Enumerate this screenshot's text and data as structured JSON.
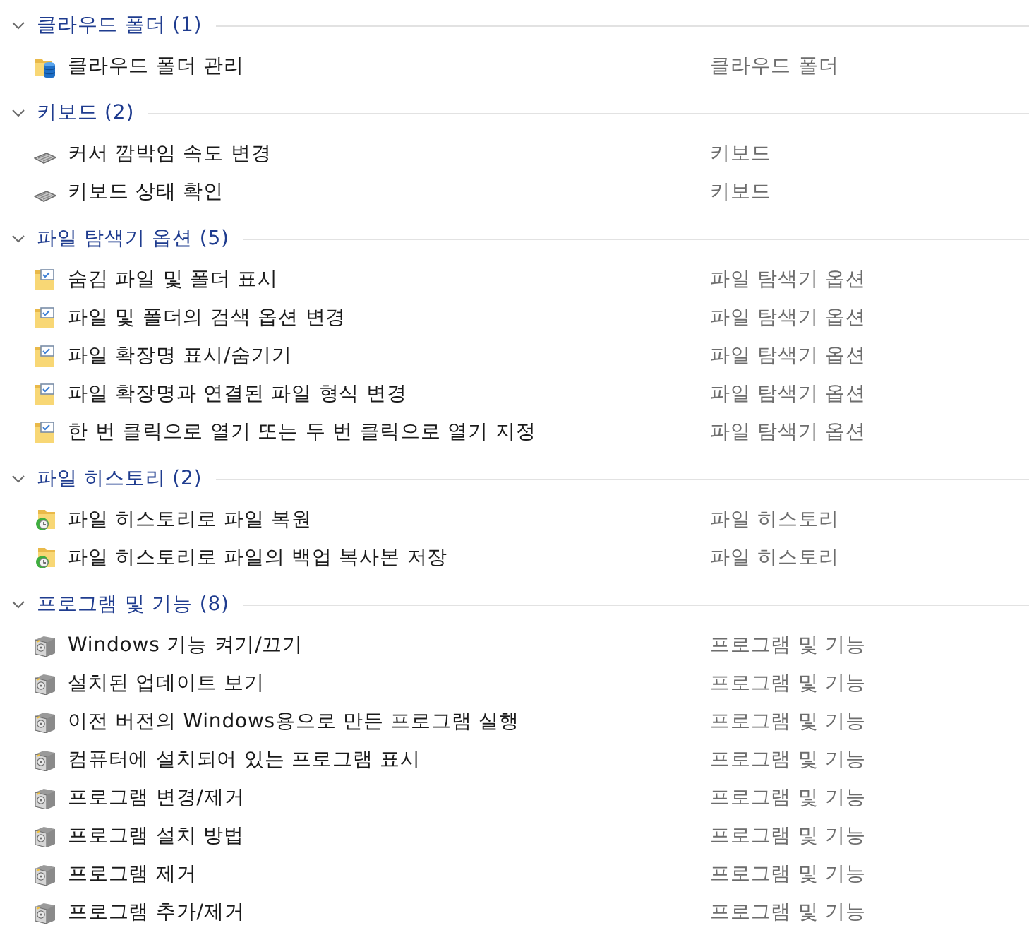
{
  "groups": [
    {
      "kind": "cloud",
      "title": "클라우드 폴더 (1)",
      "expanded": true,
      "items": [
        {
          "label": "클라우드 폴더 관리",
          "category": "클라우드 폴더"
        }
      ]
    },
    {
      "kind": "keyboard",
      "title": "키보드 (2)",
      "expanded": true,
      "items": [
        {
          "label": "커서 깜박임 속도 변경",
          "category": "키보드"
        },
        {
          "label": "키보드 상태 확인",
          "category": "키보드"
        }
      ]
    },
    {
      "kind": "options",
      "title": "파일 탐색기 옵션 (5)",
      "expanded": true,
      "items": [
        {
          "label": "숨김 파일 및 폴더 표시",
          "category": "파일 탐색기 옵션"
        },
        {
          "label": "파일 및 폴더의 검색 옵션 변경",
          "category": "파일 탐색기 옵션"
        },
        {
          "label": "파일 확장명 표시/숨기기",
          "category": "파일 탐색기 옵션"
        },
        {
          "label": "파일 확장명과 연결된 파일 형식 변경",
          "category": "파일 탐색기 옵션"
        },
        {
          "label": "한 번 클릭으로 열기 또는 두 번 클릭으로 열기 지정",
          "category": "파일 탐색기 옵션"
        }
      ]
    },
    {
      "kind": "history",
      "title": "파일 히스토리 (2)",
      "expanded": true,
      "items": [
        {
          "label": "파일 히스토리로 파일 복원",
          "category": "파일 히스토리"
        },
        {
          "label": "파일 히스토리로 파일의 백업 복사본 저장",
          "category": "파일 히스토리"
        }
      ]
    },
    {
      "kind": "programs",
      "title": "프로그램 및 기능 (8)",
      "expanded": true,
      "items": [
        {
          "label": "Windows 기능 켜기/끄기",
          "category": "프로그램 및 기능"
        },
        {
          "label": "설치된 업데이트 보기",
          "category": "프로그램 및 기능"
        },
        {
          "label": "이전 버전의 Windows용으로 만든 프로그램 실행",
          "category": "프로그램 및 기능"
        },
        {
          "label": "컴퓨터에 설치되어 있는 프로그램 표시",
          "category": "프로그램 및 기능"
        },
        {
          "label": "프로그램 변경/제거",
          "category": "프로그램 및 기능"
        },
        {
          "label": "프로그램 설치 방법",
          "category": "프로그램 및 기능"
        },
        {
          "label": "프로그램 제거",
          "category": "프로그램 및 기능"
        },
        {
          "label": "프로그램 추가/제거",
          "category": "프로그램 및 기능"
        }
      ]
    }
  ]
}
